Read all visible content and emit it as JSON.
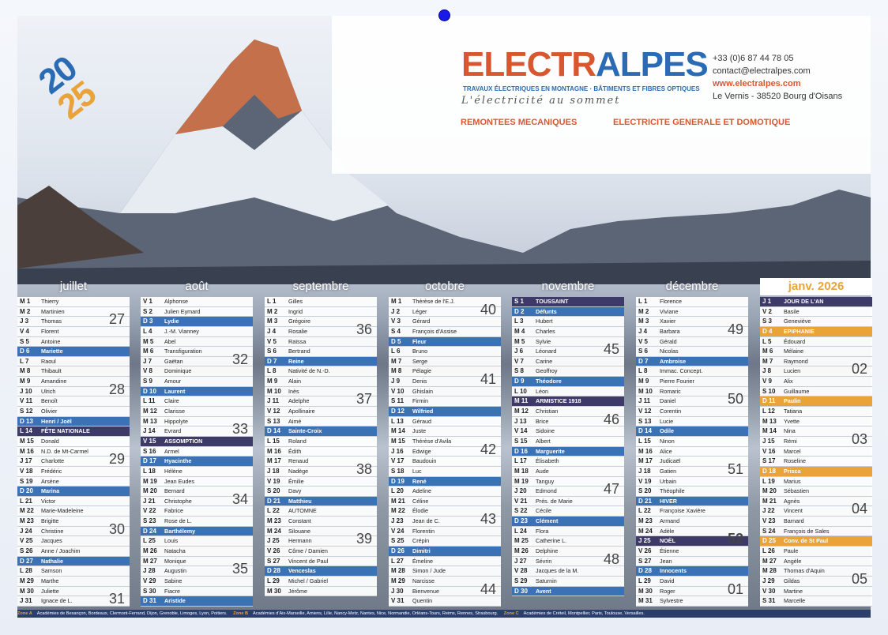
{
  "header": {
    "year_top": "20",
    "year_bottom": "25",
    "brand_a": "ELECTR",
    "brand_b": "ALPES",
    "tagline": "TRAVAUX ÉLECTRIQUES EN MONTAGNE · BÂTIMENTS ET FIBRES OPTIQUES",
    "slogan": "L'électricité au sommet",
    "phone": "+33 (0)6 87 44 78 05",
    "email": "contact@electralpes.com",
    "web": "www.electralpes.com",
    "address": "Le Vernis - 38520 Bourg d'Oisans",
    "service1": "REMONTEES MECANIQUES",
    "service2": "ELECTRICITE GENERALE ET DOMOTIQUE"
  },
  "footer": {
    "zoneA_label": "Zone A",
    "zoneA_text": "Académies de Besançon, Bordeaux, Clermont-Ferrand, Dijon, Grenoble, Limoges, Lyon, Poitiers.",
    "zoneB_label": "Zone B",
    "zoneB_text": "Académies d'Aix-Marseille, Amiens, Lille, Nancy-Metz, Nantes, Nice, Normandie, Orléans-Tours, Reims, Rennes, Strasbourg.",
    "zoneC_label": "Zone C",
    "zoneC_text": "Académies de Créteil, Montpellier, Paris, Toulouse, Versailles."
  },
  "months": [
    {
      "name": "juillet",
      "days": [
        [
          "M 1",
          "Thierry",
          ""
        ],
        [
          "M 2",
          "Martinien",
          ""
        ],
        [
          "J 3",
          "Thomas",
          ""
        ],
        [
          "V 4",
          "Florent",
          ""
        ],
        [
          "S 5",
          "Antoine",
          ""
        ],
        [
          "D 6",
          "Mariette",
          "sun"
        ],
        [
          "L 7",
          "Raoul",
          ""
        ],
        [
          "M 8",
          "Thibault",
          ""
        ],
        [
          "M 9",
          "Amandine",
          ""
        ],
        [
          "J 10",
          "Ulrich",
          ""
        ],
        [
          "V 11",
          "Benoît",
          ""
        ],
        [
          "S 12",
          "Olivier",
          ""
        ],
        [
          "D 13",
          "Henri / Joël",
          "sun"
        ],
        [
          "L 14",
          "FÊTE NATIONALE",
          "hol"
        ],
        [
          "M 15",
          "Donald",
          ""
        ],
        [
          "M 16",
          "N.D. de Mt-Carmel",
          ""
        ],
        [
          "J 17",
          "Charlotte",
          ""
        ],
        [
          "V 18",
          "Frédéric",
          ""
        ],
        [
          "S 19",
          "Arsène",
          ""
        ],
        [
          "D 20",
          "Marina",
          "sun"
        ],
        [
          "L 21",
          "Victor",
          ""
        ],
        [
          "M 22",
          "Marie-Madeleine",
          ""
        ],
        [
          "M 23",
          "Brigitte",
          ""
        ],
        [
          "J 24",
          "Christine",
          ""
        ],
        [
          "V 25",
          "Jacques",
          ""
        ],
        [
          "S 26",
          "Anne / Joachim",
          ""
        ],
        [
          "D 27",
          "Nathalie",
          "sun"
        ],
        [
          "L 28",
          "Samson",
          ""
        ],
        [
          "M 29",
          "Marthe",
          ""
        ],
        [
          "M 30",
          "Juliette",
          ""
        ],
        [
          "J 31",
          "Ignace de L.",
          ""
        ]
      ],
      "weeks": [
        [
          "27",
          3
        ],
        [
          "28",
          10
        ],
        [
          "29",
          17
        ],
        [
          "30",
          24
        ],
        [
          "31",
          31
        ]
      ]
    },
    {
      "name": "août",
      "days": [
        [
          "V 1",
          "Alphonse",
          ""
        ],
        [
          "S 2",
          "Julien Eymard",
          ""
        ],
        [
          "D 3",
          "Lydie",
          "sun"
        ],
        [
          "L 4",
          "J.-M. Vianney",
          ""
        ],
        [
          "M 5",
          "Abel",
          ""
        ],
        [
          "M 6",
          "Transfiguration",
          ""
        ],
        [
          "J 7",
          "Gaëtan",
          ""
        ],
        [
          "V 8",
          "Dominique",
          ""
        ],
        [
          "S 9",
          "Amour",
          ""
        ],
        [
          "D 10",
          "Laurent",
          "sun"
        ],
        [
          "L 11",
          "Claire",
          ""
        ],
        [
          "M 12",
          "Clarisse",
          ""
        ],
        [
          "M 13",
          "Hippolyte",
          ""
        ],
        [
          "J 14",
          "Evrard",
          ""
        ],
        [
          "V 15",
          "ASSOMPTION",
          "hol"
        ],
        [
          "S 16",
          "Armel",
          ""
        ],
        [
          "D 17",
          "Hyacinthe",
          "sun"
        ],
        [
          "L 18",
          "Hélène",
          ""
        ],
        [
          "M 19",
          "Jean Eudes",
          ""
        ],
        [
          "M 20",
          "Bernard",
          ""
        ],
        [
          "J 21",
          "Christophe",
          ""
        ],
        [
          "V 22",
          "Fabrice",
          ""
        ],
        [
          "S 23",
          "Rose de L.",
          ""
        ],
        [
          "D 24",
          "Barthélemy",
          "sun"
        ],
        [
          "L 25",
          "Louis",
          ""
        ],
        [
          "M 26",
          "Natacha",
          ""
        ],
        [
          "M 27",
          "Monique",
          ""
        ],
        [
          "J 28",
          "Augustin",
          ""
        ],
        [
          "V 29",
          "Sabine",
          ""
        ],
        [
          "S 30",
          "Fiacre",
          ""
        ],
        [
          "D 31",
          "Aristide",
          "sun"
        ]
      ],
      "weeks": [
        [
          "32",
          7
        ],
        [
          "33",
          14
        ],
        [
          "34",
          21
        ],
        [
          "35",
          28
        ]
      ]
    },
    {
      "name": "septembre",
      "days": [
        [
          "L 1",
          "Gilles",
          ""
        ],
        [
          "M 2",
          "Ingrid",
          ""
        ],
        [
          "M 3",
          "Grégoire",
          ""
        ],
        [
          "J 4",
          "Rosalie",
          ""
        ],
        [
          "V 5",
          "Raïssa",
          ""
        ],
        [
          "S 6",
          "Bertrand",
          ""
        ],
        [
          "D 7",
          "Reine",
          "sun"
        ],
        [
          "L 8",
          "Nativité de N.-D.",
          ""
        ],
        [
          "M 9",
          "Alain",
          ""
        ],
        [
          "M 10",
          "Inès",
          ""
        ],
        [
          "J 11",
          "Adelphe",
          ""
        ],
        [
          "V 12",
          "Apollinaire",
          ""
        ],
        [
          "S 13",
          "Aimé",
          ""
        ],
        [
          "D 14",
          "Sainte-Croix",
          "sun"
        ],
        [
          "L 15",
          "Roland",
          ""
        ],
        [
          "M 16",
          "Édith",
          ""
        ],
        [
          "M 17",
          "Renaud",
          ""
        ],
        [
          "J 18",
          "Nadège",
          ""
        ],
        [
          "V 19",
          "Émilie",
          ""
        ],
        [
          "S 20",
          "Davy",
          ""
        ],
        [
          "D 21",
          "Matthieu",
          "sun"
        ],
        [
          "L 22",
          "AUTOMNE",
          ""
        ],
        [
          "M 23",
          "Constant",
          ""
        ],
        [
          "M 24",
          "Silouane",
          ""
        ],
        [
          "J 25",
          "Hermann",
          ""
        ],
        [
          "V 26",
          "Côme / Damien",
          ""
        ],
        [
          "S 27",
          "Vincent de Paul",
          ""
        ],
        [
          "D 28",
          "Venceslas",
          "sun"
        ],
        [
          "L 29",
          "Michel / Gabriel",
          ""
        ],
        [
          "M 30",
          "Jérôme",
          ""
        ]
      ],
      "weeks": [
        [
          "36",
          4
        ],
        [
          "37",
          11
        ],
        [
          "38",
          18
        ],
        [
          "39",
          25
        ]
      ]
    },
    {
      "name": "octobre",
      "days": [
        [
          "M 1",
          "Thérèse de l'E.J.",
          ""
        ],
        [
          "J 2",
          "Léger",
          ""
        ],
        [
          "V 3",
          "Gérard",
          ""
        ],
        [
          "S 4",
          "François d'Assise",
          ""
        ],
        [
          "D 5",
          "Fleur",
          "sun"
        ],
        [
          "L 6",
          "Bruno",
          ""
        ],
        [
          "M 7",
          "Serge",
          ""
        ],
        [
          "M 8",
          "Pélagie",
          ""
        ],
        [
          "J 9",
          "Denis",
          ""
        ],
        [
          "V 10",
          "Ghislain",
          ""
        ],
        [
          "S 11",
          "Firmin",
          ""
        ],
        [
          "D 12",
          "Wilfried",
          "sun"
        ],
        [
          "L 13",
          "Géraud",
          ""
        ],
        [
          "M 14",
          "Juste",
          ""
        ],
        [
          "M 15",
          "Thérèse d'Avila",
          ""
        ],
        [
          "J 16",
          "Edwige",
          ""
        ],
        [
          "V 17",
          "Baudouin",
          ""
        ],
        [
          "S 18",
          "Luc",
          ""
        ],
        [
          "D 19",
          "René",
          "sun"
        ],
        [
          "L 20",
          "Adeline",
          ""
        ],
        [
          "M 21",
          "Céline",
          ""
        ],
        [
          "M 22",
          "Élodie",
          ""
        ],
        [
          "J 23",
          "Jean de C.",
          ""
        ],
        [
          "V 24",
          "Florentin",
          ""
        ],
        [
          "S 25",
          "Crépin",
          ""
        ],
        [
          "D 26",
          "Dimitri",
          "sun"
        ],
        [
          "L 27",
          "Émeline",
          ""
        ],
        [
          "M 28",
          "Simon / Jude",
          ""
        ],
        [
          "M 29",
          "Narcisse",
          ""
        ],
        [
          "J 30",
          "Bienvenue",
          ""
        ],
        [
          "V 31",
          "Quentin",
          ""
        ]
      ],
      "weeks": [
        [
          "40",
          2
        ],
        [
          "41",
          9
        ],
        [
          "42",
          16
        ],
        [
          "43",
          23
        ],
        [
          "44",
          30
        ]
      ]
    },
    {
      "name": "novembre",
      "days": [
        [
          "S 1",
          "TOUSSAINT",
          "hol"
        ],
        [
          "D 2",
          "Défunts",
          "sun"
        ],
        [
          "L 3",
          "Hubert",
          ""
        ],
        [
          "M 4",
          "Charles",
          ""
        ],
        [
          "M 5",
          "Sylvie",
          ""
        ],
        [
          "J 6",
          "Léonard",
          ""
        ],
        [
          "V 7",
          "Carine",
          ""
        ],
        [
          "S 8",
          "Geoffroy",
          ""
        ],
        [
          "D 9",
          "Théodore",
          "sun"
        ],
        [
          "L 10",
          "Léon",
          ""
        ],
        [
          "M 11",
          "ARMISTICE 1918",
          "hol"
        ],
        [
          "M 12",
          "Christian",
          ""
        ],
        [
          "J 13",
          "Brice",
          ""
        ],
        [
          "V 14",
          "Sidoine",
          ""
        ],
        [
          "S 15",
          "Albert",
          ""
        ],
        [
          "D 16",
          "Marguerite",
          "sun"
        ],
        [
          "L 17",
          "Élisabeth",
          ""
        ],
        [
          "M 18",
          "Aude",
          ""
        ],
        [
          "M 19",
          "Tanguy",
          ""
        ],
        [
          "J 20",
          "Edmond",
          ""
        ],
        [
          "V 21",
          "Prés. de Marie",
          ""
        ],
        [
          "S 22",
          "Cécile",
          ""
        ],
        [
          "D 23",
          "Clément",
          "sun"
        ],
        [
          "L 24",
          "Flora",
          ""
        ],
        [
          "M 25",
          "Catherine L.",
          ""
        ],
        [
          "M 26",
          "Delphine",
          ""
        ],
        [
          "J 27",
          "Sévrin",
          ""
        ],
        [
          "V 28",
          "Jacques de la M.",
          ""
        ],
        [
          "S 29",
          "Saturnin",
          ""
        ],
        [
          "D 30",
          "Avent",
          "sun"
        ]
      ],
      "weeks": [
        [
          "45",
          6
        ],
        [
          "46",
          13
        ],
        [
          "47",
          20
        ],
        [
          "48",
          27
        ]
      ]
    },
    {
      "name": "décembre",
      "days": [
        [
          "L 1",
          "Florence",
          ""
        ],
        [
          "M 2",
          "Viviane",
          ""
        ],
        [
          "M 3",
          "Xavier",
          ""
        ],
        [
          "J 4",
          "Barbara",
          ""
        ],
        [
          "V 5",
          "Gérald",
          ""
        ],
        [
          "S 6",
          "Nicolas",
          ""
        ],
        [
          "D 7",
          "Ambroise",
          "sun"
        ],
        [
          "L 8",
          "Immac. Concept.",
          ""
        ],
        [
          "M 9",
          "Pierre Fourier",
          ""
        ],
        [
          "M 10",
          "Romaric",
          ""
        ],
        [
          "J 11",
          "Daniel",
          ""
        ],
        [
          "V 12",
          "Corentin",
          ""
        ],
        [
          "S 13",
          "Lucie",
          ""
        ],
        [
          "D 14",
          "Odile",
          "sun"
        ],
        [
          "L 15",
          "Ninon",
          ""
        ],
        [
          "M 16",
          "Alice",
          ""
        ],
        [
          "M 17",
          "Judicaël",
          ""
        ],
        [
          "J 18",
          "Gatien",
          ""
        ],
        [
          "V 19",
          "Urbain",
          ""
        ],
        [
          "S 20",
          "Théophile",
          ""
        ],
        [
          "D 21",
          "HIVER",
          "sun"
        ],
        [
          "L 22",
          "Françoise Xavière",
          ""
        ],
        [
          "M 23",
          "Armand",
          ""
        ],
        [
          "M 24",
          "Adèle",
          ""
        ],
        [
          "J 25",
          "NOËL",
          "hol"
        ],
        [
          "V 26",
          "Étienne",
          ""
        ],
        [
          "S 27",
          "Jean",
          ""
        ],
        [
          "D 28",
          "Innocents",
          "sun"
        ],
        [
          "L 29",
          "David",
          ""
        ],
        [
          "M 30",
          "Roger",
          ""
        ],
        [
          "M 31",
          "Sylvestre",
          ""
        ]
      ],
      "weeks": [
        [
          "49",
          4
        ],
        [
          "50",
          11
        ],
        [
          "51",
          18
        ],
        [
          "52",
          25
        ],
        [
          "01",
          30
        ]
      ]
    },
    {
      "name": "janv. 2026",
      "days": [
        [
          "J 1",
          "JOUR DE L'AN",
          "hol"
        ],
        [
          "V 2",
          "Basile",
          ""
        ],
        [
          "S 3",
          "Geneviève",
          ""
        ],
        [
          "D 4",
          "EPIPHANIE",
          "vac"
        ],
        [
          "L 5",
          "Édouard",
          ""
        ],
        [
          "M 6",
          "Mélaine",
          ""
        ],
        [
          "M 7",
          "Raymond",
          ""
        ],
        [
          "J 8",
          "Lucien",
          ""
        ],
        [
          "V 9",
          "Alix",
          ""
        ],
        [
          "S 10",
          "Guillaume",
          ""
        ],
        [
          "D 11",
          "Paulin",
          "vac"
        ],
        [
          "L 12",
          "Tatiana",
          ""
        ],
        [
          "M 13",
          "Yvette",
          ""
        ],
        [
          "M 14",
          "Nina",
          ""
        ],
        [
          "J 15",
          "Rémi",
          ""
        ],
        [
          "V 16",
          "Marcel",
          ""
        ],
        [
          "S 17",
          "Roseline",
          ""
        ],
        [
          "D 18",
          "Prisca",
          "vac"
        ],
        [
          "L 19",
          "Marius",
          ""
        ],
        [
          "M 20",
          "Sébastien",
          ""
        ],
        [
          "M 21",
          "Agnès",
          ""
        ],
        [
          "J 22",
          "Vincent",
          ""
        ],
        [
          "V 23",
          "Barnard",
          ""
        ],
        [
          "S 24",
          "François de Sales",
          ""
        ],
        [
          "D 25",
          "Conv. de St Paul",
          "vac"
        ],
        [
          "L 26",
          "Paule",
          ""
        ],
        [
          "M 27",
          "Angèle",
          ""
        ],
        [
          "M 28",
          "Thomas d'Aquin",
          ""
        ],
        [
          "J 29",
          "Gildas",
          ""
        ],
        [
          "V 30",
          "Martine",
          ""
        ],
        [
          "S 31",
          "Marcelle",
          ""
        ]
      ],
      "weeks": [
        [
          "02",
          8
        ],
        [
          "03",
          15
        ],
        [
          "04",
          22
        ],
        [
          "05",
          29
        ]
      ]
    }
  ]
}
